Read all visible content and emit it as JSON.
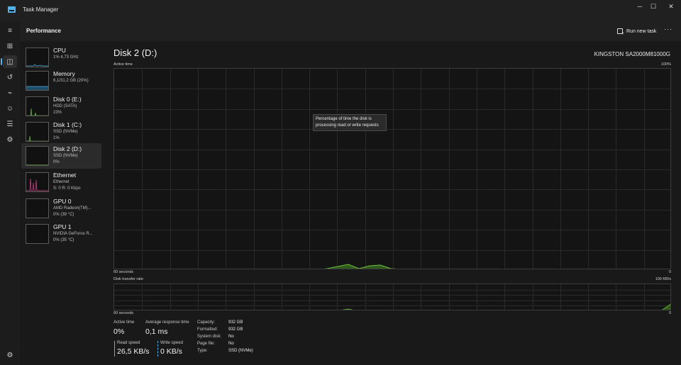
{
  "window": {
    "title": "Task Manager",
    "minimize_glyph": "─",
    "maximize_glyph": "☐",
    "close_glyph": "✕"
  },
  "header": {
    "page_title": "Performance",
    "run_task_label": "Run new task",
    "more_glyph": "···"
  },
  "rail": [
    {
      "icon": "hamburger-menu-icon",
      "glyph": "≡"
    },
    {
      "icon": "processes-icon",
      "glyph": "⊞"
    },
    {
      "icon": "performance-icon",
      "glyph": "◫"
    },
    {
      "icon": "app-history-icon",
      "glyph": "↺"
    },
    {
      "icon": "startup-apps-icon",
      "glyph": "⌁"
    },
    {
      "icon": "users-icon",
      "glyph": "☺"
    },
    {
      "icon": "details-icon",
      "glyph": "☰"
    },
    {
      "icon": "services-icon",
      "glyph": "⚙"
    },
    {
      "icon": "settings-icon",
      "glyph": "⚙"
    }
  ],
  "devices": [
    {
      "name": "CPU",
      "line1": "1% 4,73 GHz",
      "line2": "",
      "color": "#4fb2ea"
    },
    {
      "name": "Memory",
      "line1": "6,1/31,2 GB (20%)",
      "line2": "",
      "color": "#4fb2ea"
    },
    {
      "name": "Disk 0 (E:)",
      "line1": "HDD (SATA)",
      "line2": "23%",
      "color": "#6fbf3f"
    },
    {
      "name": "Disk 1 (C:)",
      "line1": "SSD (NVMe)",
      "line2": "1%",
      "color": "#6fbf3f"
    },
    {
      "name": "Disk 2 (D:)",
      "line1": "SSD (NVMe)",
      "line2": "0%",
      "color": "#6fbf3f"
    },
    {
      "name": "Ethernet",
      "line1": "Ethernet",
      "line2": "S: 0 R: 0 Kbps",
      "color": "#d9468f"
    },
    {
      "name": "GPU 0",
      "line1": "AMD Radeon(TM)...",
      "line2": "0% (39 °C)",
      "color": "#4fb2ea"
    },
    {
      "name": "GPU 1",
      "line1": "NVIDIA GeForce R...",
      "line2": "0% (35 °C)",
      "color": "#4fb2ea"
    }
  ],
  "main": {
    "disk_title": "Disk 2 (D:)",
    "model": "KINGSTON SA2000M81000G",
    "active_time_graph": {
      "label": "Active time",
      "max_label": "100%",
      "time_label": "60 seconds",
      "min_label": "0",
      "tooltip_line1": "Percentage of time the disk is",
      "tooltip_line2": "processing read or write requests"
    },
    "transfer_graph": {
      "label": "Disk transfer rate",
      "max_label": "100 KB/s",
      "time_label": "60 seconds",
      "min_label": "0"
    },
    "graph_color": "#6fbf3f"
  },
  "stats": {
    "active_time_label": "Active time",
    "active_time_value": "0%",
    "avg_response_label": "Average response time",
    "avg_response_value": "0,1 ms",
    "read_speed_label": "Read speed",
    "read_speed_value": "26,5 KB/s",
    "write_speed_label": "Write speed",
    "write_speed_value": "0 KB/s"
  },
  "properties": [
    {
      "key": "Capacity:",
      "value": "932 GB"
    },
    {
      "key": "Formatted:",
      "value": "932 GB"
    },
    {
      "key": "System disk:",
      "value": "No"
    },
    {
      "key": "Page file:",
      "value": "No"
    },
    {
      "key": "Type:",
      "value": "SSD (NVMe)"
    }
  ]
}
